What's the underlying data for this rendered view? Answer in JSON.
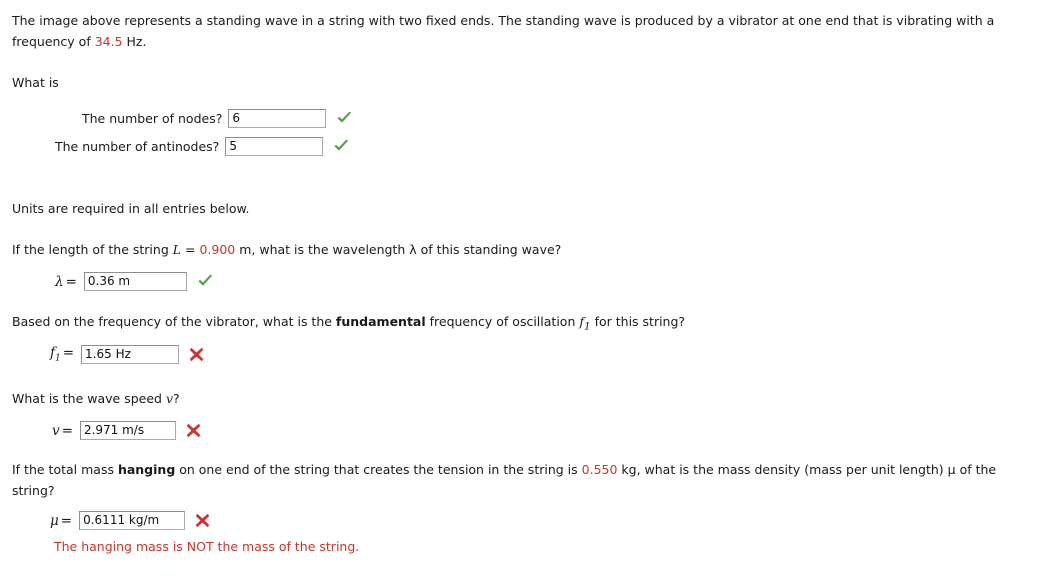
{
  "intro": {
    "part1": "The image above represents a standing wave in a string with two fixed ends. The standing wave is produced by a vibrator at one end that is vibrating with a frequency of ",
    "frequency_value": "34.5",
    "part2": " Hz."
  },
  "what_is_label": "What is",
  "questions": {
    "nodes": {
      "label": "The number of nodes?",
      "value": "6",
      "status": "correct"
    },
    "antinodes": {
      "label": "The number of antinodes?",
      "value": "5",
      "status": "correct"
    }
  },
  "units_notice": "Units are required in all entries below.",
  "wavelength": {
    "prompt_part1": "If the length of the string ",
    "prompt_var": "L",
    "prompt_eq": " = ",
    "prompt_value": "0.900",
    "prompt_part2": " m, what is the wavelength λ of this standing wave?",
    "symbol": "λ",
    "equals": "=",
    "value": "0.36 m",
    "status": "correct"
  },
  "fundamental": {
    "prompt_part1": "Based on the frequency of the vibrator, what is the ",
    "prompt_bold": "fundamental",
    "prompt_part2": " frequency of oscillation ",
    "prompt_symbol": "f",
    "prompt_subscript": "1",
    "prompt_part3": " for this string?",
    "symbol": "f",
    "subscript": "1",
    "equals": "=",
    "value": "1.65 Hz",
    "status": "incorrect"
  },
  "wave_speed": {
    "prompt": "What is the wave speed ",
    "prompt_var": "v",
    "prompt_end": "?",
    "symbol": "v",
    "equals": "=",
    "value": "2.971 m/s",
    "status": "incorrect"
  },
  "mass_density": {
    "prompt_part1": "If the total mass ",
    "prompt_bold": "hanging",
    "prompt_part2": " on one end of the string that creates the tension in the string is ",
    "prompt_value": "0.550",
    "prompt_part3": " kg, what is the mass density (mass per unit length) μ",
    "prompt_part4": "of the string?",
    "symbol": "μ",
    "equals": "=",
    "value": "0.6111 kg/m",
    "status": "incorrect",
    "error_message": "The hanging mass is NOT the mass of the string."
  },
  "colors": {
    "value_red": "#c0392b",
    "correct_green": "#5a9e4f",
    "incorrect_red": "#cc3333",
    "text": "#1a1a1a",
    "field_border": "#a9a9a9"
  }
}
